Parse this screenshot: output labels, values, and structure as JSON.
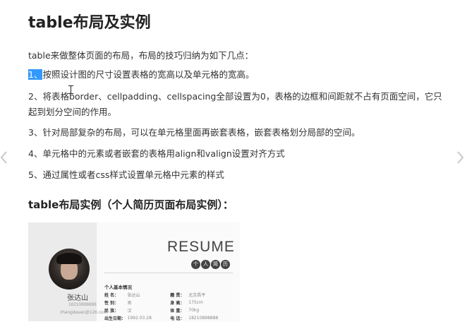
{
  "page": {
    "title": "table布局及实例",
    "intro": "table来做整体页面的布局，布局的技巧归纳为如下几点：",
    "points": [
      {
        "num": "1、",
        "text": "按照设计图的尺寸设置表格的宽高以及单元格的宽高。"
      },
      {
        "text": "2、将表格border、cellpadding、cellspacing全部设置为0，表格的边框和间距就不占有页面空间，它只起到划分空间的作用。"
      },
      {
        "text": "3、针对局部复杂的布局，可以在单元格里面再嵌套表格，嵌套表格划分局部的空间。"
      },
      {
        "text": "4、单元格中的元素或者嵌套的表格用align和valign设置对齐方式"
      },
      {
        "text": "5、通过属性或者css样式设置单元格中元素的样式"
      }
    ],
    "subtitle": "table布局实例（个人简历页面布局实例）："
  },
  "resume": {
    "heading": "RESUME",
    "badges": [
      "个",
      "人",
      "简",
      "历"
    ],
    "name": "张达山",
    "phone": "18210898888",
    "email": "zhangdasan@126.com",
    "info_heading": "个人基本情况",
    "rows": [
      {
        "k1": "姓 名：",
        "v1": "张达山",
        "k2": "籍 贯：",
        "v2": "北京昌平"
      },
      {
        "k1": "性 别：",
        "v1": "男",
        "k2": "身 高：",
        "v2": "175cm"
      },
      {
        "k1": "民 族：",
        "v1": "汉",
        "k2": "体 重：",
        "v2": "70kg"
      },
      {
        "k1": "出生日期：",
        "v1": "1992.03.28",
        "k2": "电 话：",
        "v2": "18210898888"
      }
    ]
  },
  "icons": {
    "left_nav": "chevron-left-icon",
    "right_nav": "chevron-right-icon"
  },
  "colors": {
    "selection": "#3399ff",
    "text": "#333333",
    "nav_arrow": "#c8c8c8"
  }
}
